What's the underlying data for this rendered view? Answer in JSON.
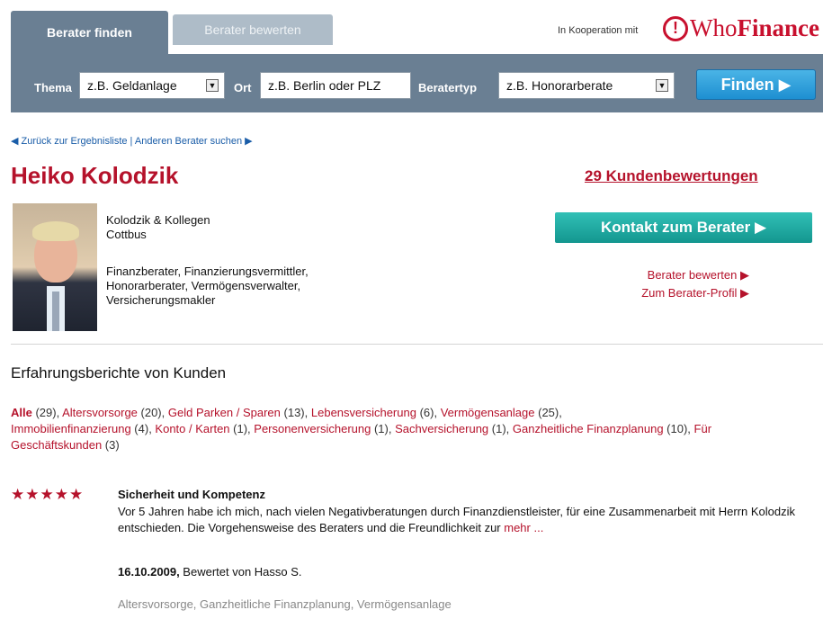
{
  "tabs": {
    "active": "Berater finden",
    "inactive": "Berater bewerten"
  },
  "cooperation": {
    "label": "In Kooperation mit",
    "logo_who": "Who",
    "logo_finance": "Finance",
    "logo_mark": "!"
  },
  "search": {
    "thema_label": "Thema",
    "thema_value": "z.B. Geldanlage",
    "ort_label": "Ort",
    "ort_value": "z.B. Berlin oder PLZ",
    "typ_label": "Beratertyp",
    "typ_value": "z.B. Honorarberate",
    "find_button": "Finden ▶"
  },
  "nav": {
    "back": "◀ Zurück zur Ergebnisliste | Anderen Berater suchen ▶"
  },
  "advisor": {
    "name": "Heiko Kolodzik",
    "reviews_link": "29 Kundenbewertungen",
    "company": "Kolodzik & Kollegen",
    "city": "Cottbus",
    "roles_line1": "Finanzberater, Finanzierungsvermittler,",
    "roles_line2": "Honorarberater, Vermögensverwalter,",
    "roles_line3": "Versicherungsmakler",
    "contact_button": "Kontakt zum Berater ▶",
    "rate_link": "Berater bewerten ▶",
    "profile_link": "Zum Berater-Profil ▶"
  },
  "reviews_section": {
    "title": "Erfahrungsberichte von Kunden",
    "categories": [
      {
        "label": "Alle",
        "count": " (29), "
      },
      {
        "label": "Altersvorsorge",
        "count": " (20), "
      },
      {
        "label": "Geld Parken / Sparen",
        "count": " (13), "
      },
      {
        "label": "Lebensversicherung",
        "count": " (6), "
      },
      {
        "label": "Vermögensanlage",
        "count": " (25), "
      },
      {
        "label": "Immobilienfinanzierung",
        "count": " (4), "
      },
      {
        "label": "Konto / Karten",
        "count": " (1), "
      },
      {
        "label": "Personenversicherung",
        "count": " (1), "
      },
      {
        "label": "Sachversicherung",
        "count": " (1), "
      },
      {
        "label": "Ganzheitliche Finanzplanung",
        "count": " (10), "
      },
      {
        "label": "Für Geschäftskunden",
        "count": " (3)"
      }
    ]
  },
  "review": {
    "stars": "★★★★★",
    "rating": 5,
    "title": "Sicherheit und Kompetenz",
    "body": "Vor 5 Jahren habe ich mich, nach vielen Negativberatungen durch Finanzdienstleister, für eine Zusammenarbeit mit Herrn Kolodzik entschieden. Die Vorgehensweise des Beraters und die Freundlichkeit zur ",
    "more": "mehr ...",
    "date": "16.10.2009,",
    "by": " Bewertet von Hasso S.",
    "tags": "Altersvorsorge, Ganzheitliche Finanzplanung, Vermögensanlage"
  },
  "colors": {
    "brand_red": "#b5122b",
    "bar": "#6a7f93",
    "find_blue": "#1e8fd1",
    "contact_teal": "#13968f"
  }
}
